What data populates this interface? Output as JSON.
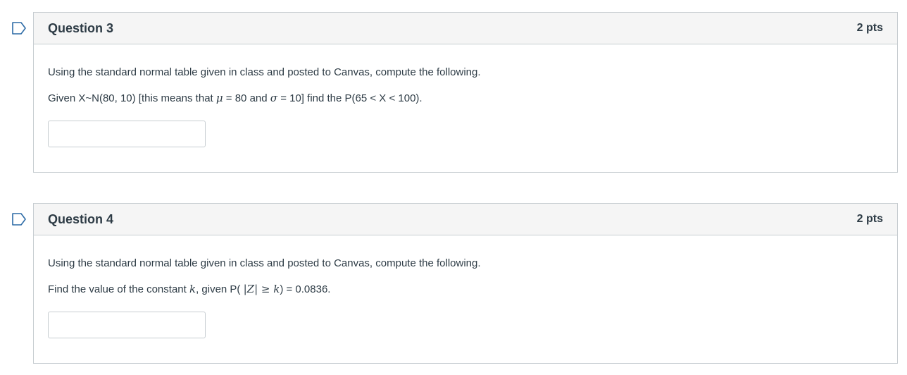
{
  "questions": [
    {
      "title": "Question 3",
      "points": "2 pts",
      "intro": "Using the standard normal table given in class and posted to Canvas, compute the following.",
      "prompt_parts": {
        "p1": "Given X~N(80, 10) [this means that ",
        "mu": "μ",
        "p2": " = 80 and ",
        "sigma": "σ",
        "p3": " = 10] find the P(65 < X < 100)."
      },
      "answer_value": ""
    },
    {
      "title": "Question 4",
      "points": "2 pts",
      "intro": "Using the standard normal table given in class and posted to Canvas, compute the following.",
      "prompt_parts": {
        "p1": "Find the value of the constant ",
        "k": "k",
        "p2": ", given P( ",
        "absz": "|Z| ≥ k",
        "p3": ") = 0.0836."
      },
      "answer_value": ""
    }
  ],
  "icons": {
    "flag": "flag-question-icon"
  },
  "colors": {
    "text": "#2d3b45",
    "border": "#c7cdd1",
    "header_bg": "#f5f5f5"
  }
}
